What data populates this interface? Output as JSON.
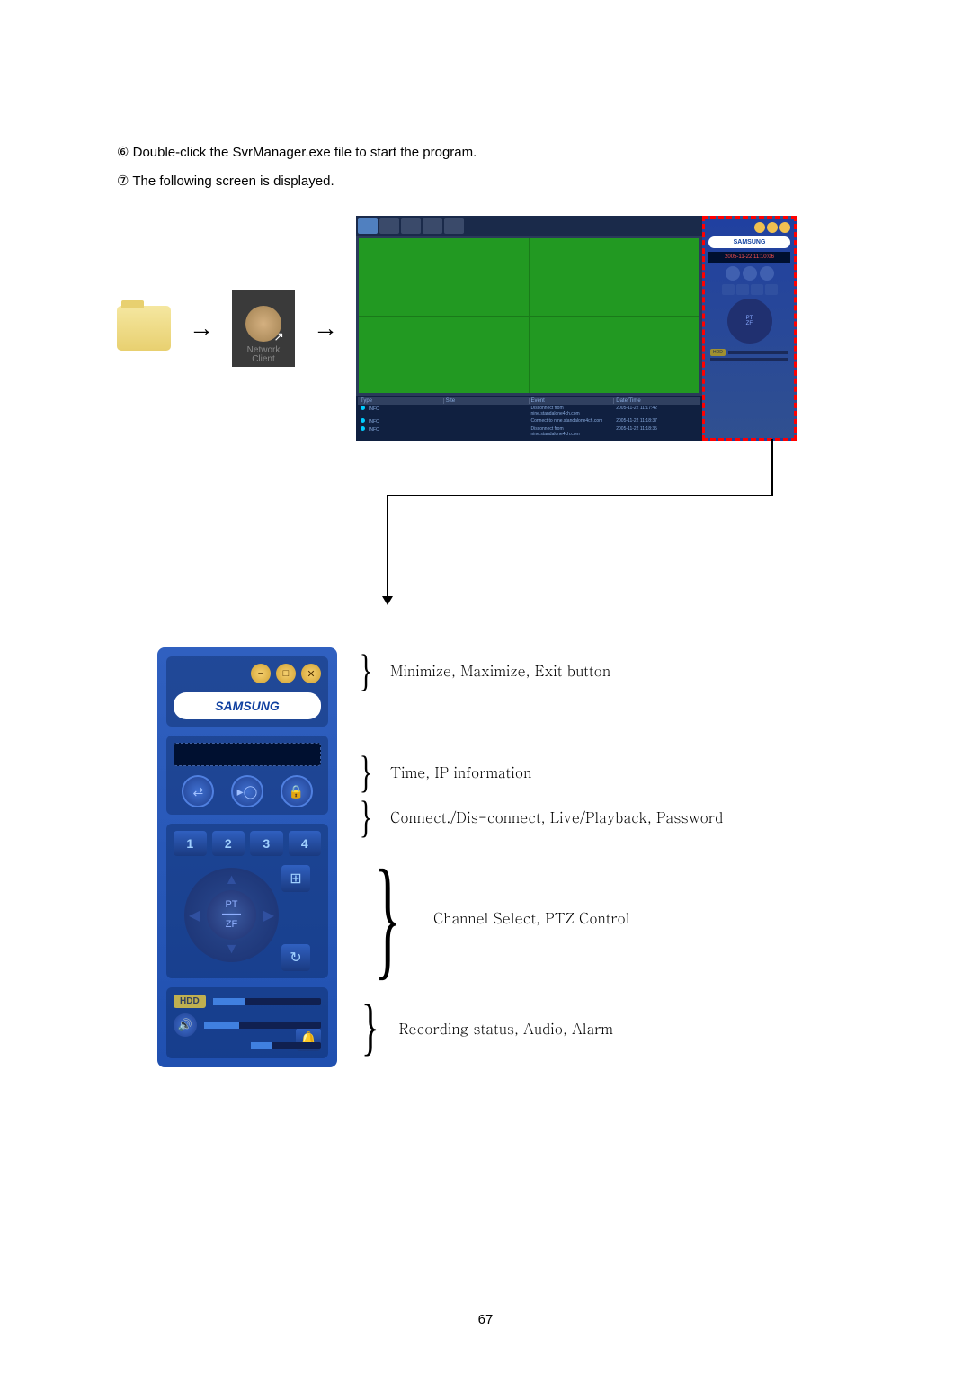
{
  "instructions": {
    "step6": "⑥ Double-click the SvrManager.exe file to start the program.",
    "step7": "⑦ The following screen is displayed."
  },
  "networkClientLabel1": "Network",
  "networkClientLabel2": "Client",
  "brand": "SAMSUNG",
  "timeMini": "2005-11-22 11:10:06",
  "logTable": {
    "headers": [
      "Type",
      "Site",
      "Event",
      "Date/Time"
    ],
    "rows": [
      {
        "type": "INFO",
        "event": "Disconnect from nine.standalone4ch.com",
        "datetime": "2005-11-22 11:17:42"
      },
      {
        "type": "INFO",
        "event": "Connect to nine.standalone4ch.com",
        "datetime": "2005-11-22 11:18:37"
      },
      {
        "type": "INFO",
        "event": "Disconnect from nine.standalone4ch.com",
        "datetime": "2005-11-22 11:18:35"
      }
    ]
  },
  "ptz": {
    "label1": "PT",
    "label2": "ZF"
  },
  "channels": [
    "1",
    "2",
    "3",
    "4"
  ],
  "hddLabel": "HDD",
  "annotations": {
    "windowControls": "Minimize, Maximize, Exit button",
    "timeInfo": "Time, IP information",
    "connect": "Connect./Dis-connect,  Live/Playback, Password",
    "channelPtz": "Channel Select, PTZ Control",
    "status": "Recording status, Audio, Alarm"
  },
  "pageNumber": "67"
}
